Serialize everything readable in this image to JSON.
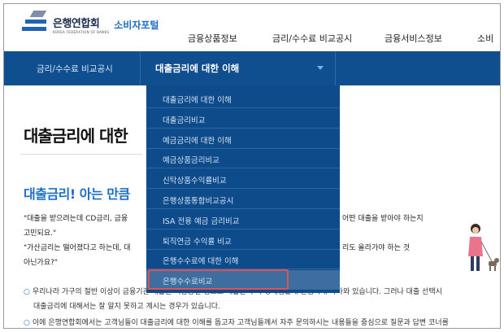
{
  "header": {
    "logo_name": "은행연합회",
    "logo_en": "KOREA FEDERATION OF BANKS",
    "site_name": "소비자포털",
    "nav": [
      "금융상품정보",
      "금리/수수료 비교공시",
      "금융서비스정보",
      "소비"
    ]
  },
  "subnav": {
    "section": "금리/수수료 비교공시",
    "current": "대출금리에 대한 이해"
  },
  "dropdown": {
    "items": [
      "대출금리에 대한 이해",
      "대출금리비교",
      "예금금리에 대한 이해",
      "예금상품금리비교",
      "신탁상품수익률비교",
      "은행상품통합비교공시",
      "ISA 전용 예금 금리비교",
      "퇴직연금 수익률 비교",
      "은행수수료에 대한 이해",
      "은행수수료비교"
    ]
  },
  "page": {
    "title": "대출금리에 대한",
    "subhead": "대출금리! 아는 만큼",
    "quote1_a": "\"대출을 받으려는데 CD금리, 금융",
    "quote1_b": "어떤 대출을 받아야 하는지",
    "quote1_c": "고민되요.\"",
    "quote2_a": "\"가산금리는 떨어졌다고 하는데, 대",
    "quote2_b": "리도 올라가야 하는 것",
    "quote2_c": "아닌가요?\"",
    "bullet1_a": "우리나라 가구의 절반 이상이 금융기관 대출을 이용중일 정도로 대출은 우리 경제생활에 밀접하게 다가와 있습니다. 그러나 대출 선택시",
    "bullet1_b": "대출금리에 대해서는 잘 알지 못하고 계시는 경우가 있습니다.",
    "bullet2": "이에 은행연합회에서는 고객님들이 대출금리에 대한 이해를 돕고자 고객님들께서 자주 문의하시는 내용들을 중심으로 질문과 답변 코너를"
  },
  "colors": {
    "accent": "#1d6fc4",
    "navbar": "#0f4e8f",
    "highlight_border": "#e05151"
  }
}
